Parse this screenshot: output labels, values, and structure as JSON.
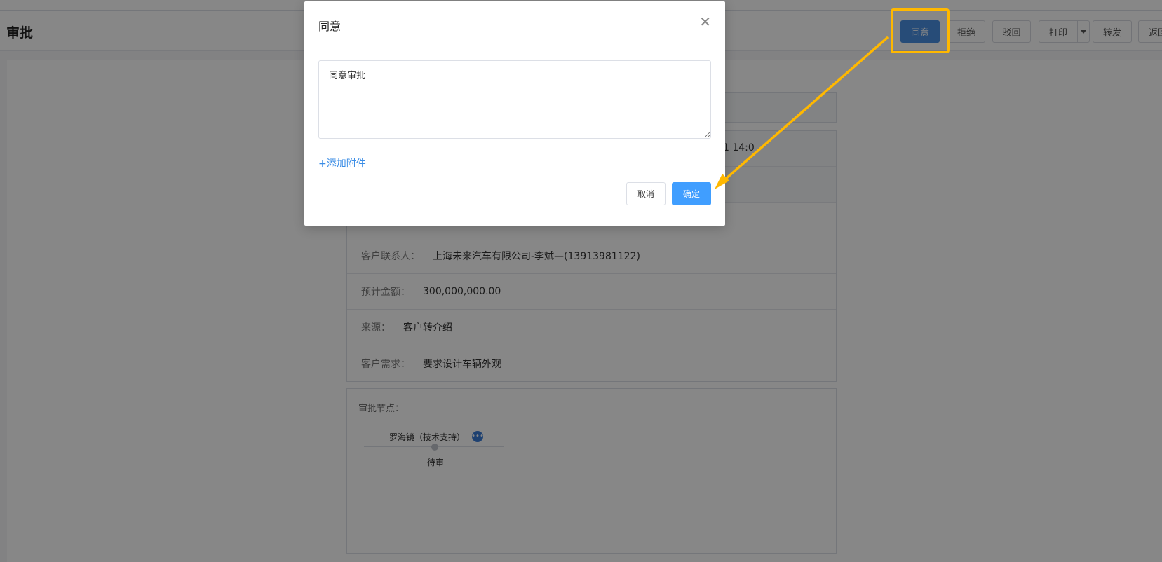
{
  "header": {
    "title": "审批",
    "buttons": {
      "approve": "同意",
      "reject": "拒绝",
      "return": "驳回",
      "print": "打印",
      "forward": "转发",
      "back": "返回"
    }
  },
  "detail": {
    "partial_time": "1 14:0",
    "rows": [
      {
        "label": "客户联系人：",
        "value": "上海未来汽车有限公司-李斌—(13913981122)"
      },
      {
        "label": "预计金额：",
        "value": "300,000,000.00"
      },
      {
        "label": "来源：",
        "value": "客户转介绍"
      },
      {
        "label": "客户需求：",
        "value": "要求设计车辆外观"
      }
    ]
  },
  "approval_nodes": {
    "label": "审批节点：",
    "node": {
      "name": "罗海镜（技术支持）",
      "status": "待审"
    }
  },
  "modal": {
    "title": "同意",
    "comment": "同意审批",
    "add_attachment": "+添加附件",
    "cancel": "取消",
    "confirm": "确定"
  },
  "colors": {
    "primary": "#409eff",
    "highlight": "#ffb800",
    "link": "#3b8de6"
  }
}
